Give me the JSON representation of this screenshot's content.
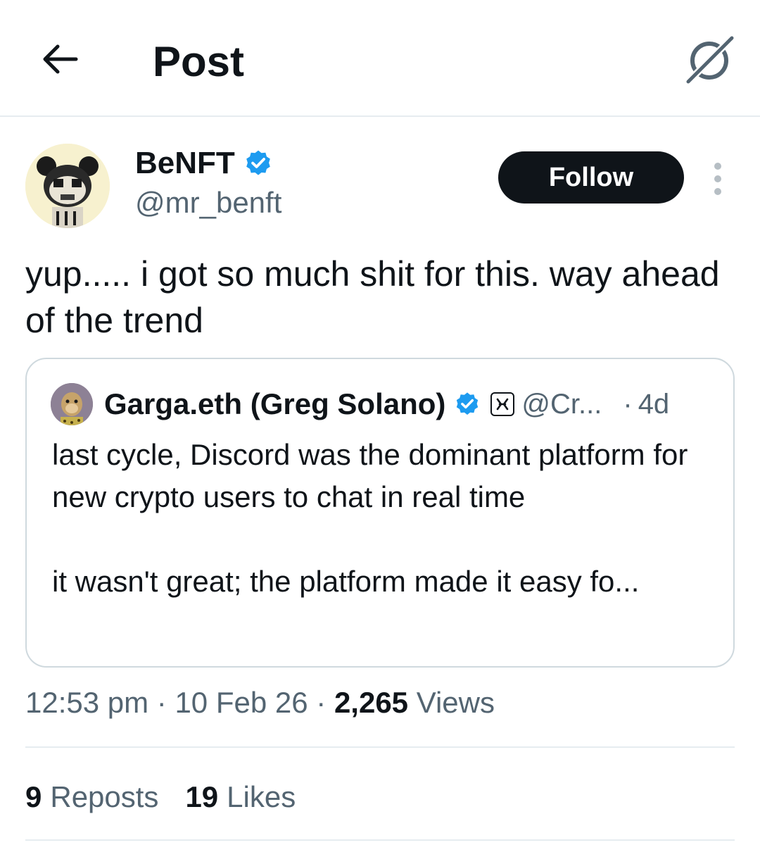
{
  "header": {
    "title": "Post",
    "back_icon": "arrow-left-icon",
    "grok_icon": "grok-icon"
  },
  "author": {
    "name": "BeNFT",
    "handle": "@mr_benft",
    "verified": true,
    "follow_label": "Follow",
    "more_icon": "more-vertical-icon"
  },
  "post": {
    "text": "yup..... i got so much shit for this.  way ahead of the trend"
  },
  "quote": {
    "name": "Garga.eth (Greg Solano)",
    "verified": true,
    "handle": "@Cr...",
    "time": "4d",
    "separator": "·",
    "paragraph1": "last cycle, Discord was the dominant platform for new crypto users to chat in real time",
    "paragraph2": "it wasn't great; the platform made it easy fo..."
  },
  "meta": {
    "time": "12:53 pm",
    "date": "10 Feb 26",
    "separator": " · ",
    "views_count": "2,265",
    "views_label": "Views"
  },
  "stats": {
    "reposts_count": "9",
    "reposts_label": "Reposts",
    "likes_count": "19",
    "likes_label": "Likes"
  },
  "colors": {
    "text_primary": "#0f1419",
    "text_secondary": "#536471",
    "verified_blue": "#1d9bf0",
    "border": "#cfd9de"
  }
}
